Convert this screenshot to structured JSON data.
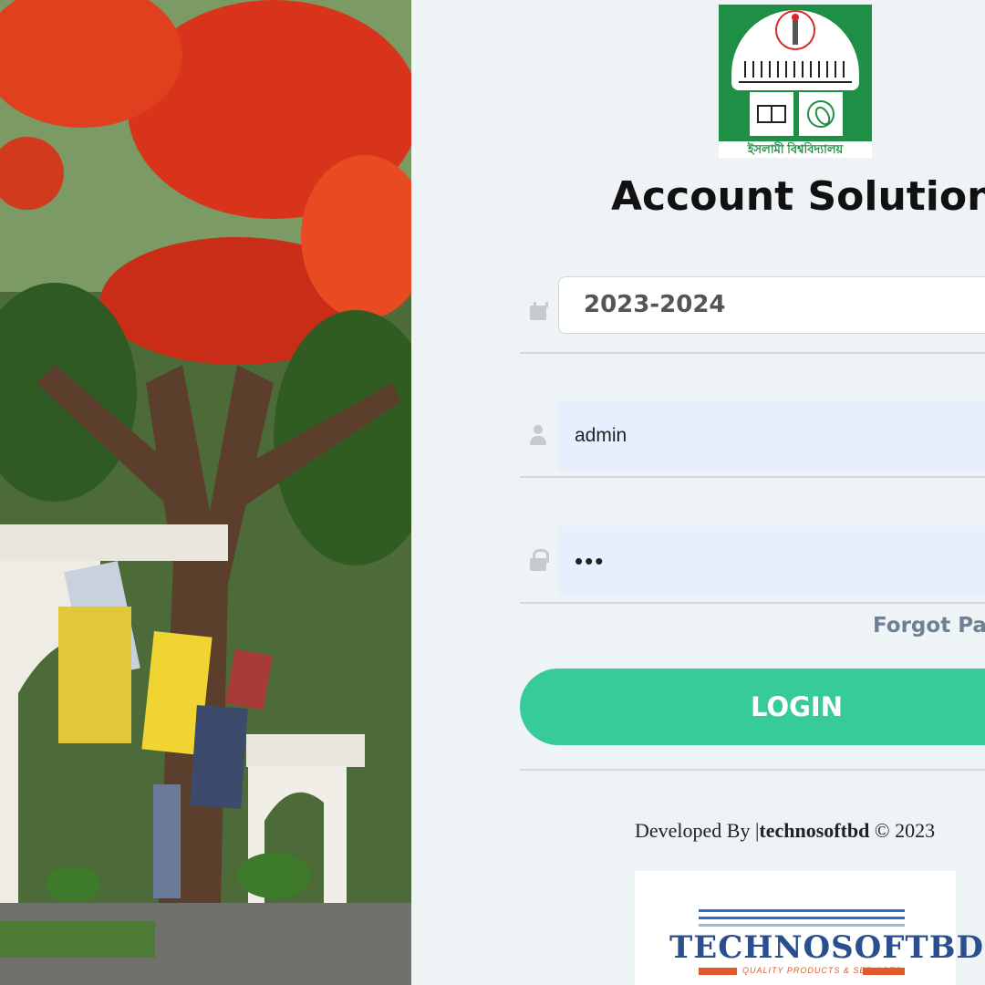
{
  "app": {
    "title": "Account Solution",
    "logo_text": "ইসলামী বিশ্ববিদ্যালয়"
  },
  "form": {
    "session_value": "2023-2024",
    "username_value": "admin",
    "password_value": "•••",
    "forgot_label": "Forgot Pas",
    "login_label": "LOGIN"
  },
  "footer": {
    "credit_prefix": "Developed By |",
    "credit_company": "technosoftbd",
    "credit_suffix": " © 2023",
    "dev_logo_brand": "TECHNOSOFTBD",
    "dev_logo_tagline": "QUALITY PRODUCTS & SERVICES"
  },
  "icons": {
    "session": "calendar-icon",
    "username": "user-icon",
    "password": "lock-icon"
  },
  "colors": {
    "accent": "#37cb99",
    "logo_green": "#1e8f44",
    "input_fill": "#e8effc",
    "link": "#6e8092"
  }
}
